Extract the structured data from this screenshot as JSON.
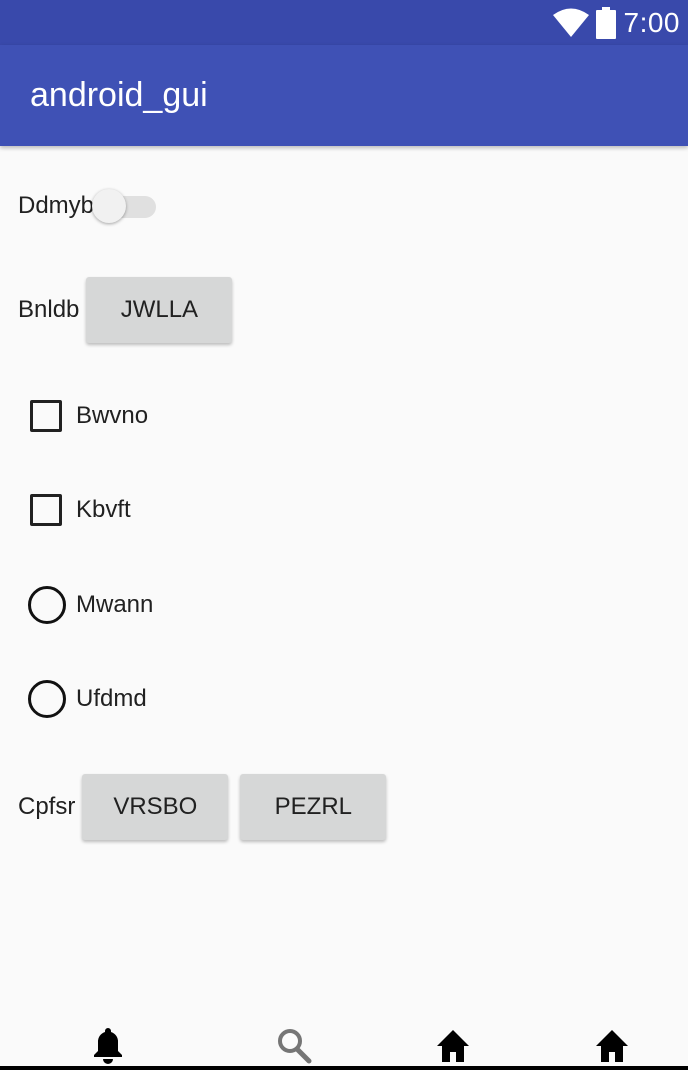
{
  "status_bar": {
    "time": "7:00"
  },
  "app_bar": {
    "title": "android_gui"
  },
  "switch_row": {
    "label": "Ddmyb",
    "checked": false
  },
  "button_row_1": {
    "label": "Bnldb",
    "button": "JWLLA"
  },
  "checkboxes": [
    {
      "label": "Bwvno",
      "checked": false
    },
    {
      "label": "Kbvft",
      "checked": false
    }
  ],
  "radios": [
    {
      "label": "Mwann",
      "selected": false
    },
    {
      "label": "Ufdmd",
      "selected": false
    }
  ],
  "button_row_2": {
    "label": "Cpfsr",
    "buttons": [
      "VRSBO",
      "PEZRL"
    ]
  },
  "bottom_nav": {
    "items": [
      {
        "icon": "bell-icon",
        "color": "#000000"
      },
      {
        "icon": "search-icon",
        "color": "#757575"
      },
      {
        "icon": "home-icon",
        "color": "#000000"
      },
      {
        "icon": "home-icon",
        "color": "#000000"
      }
    ]
  },
  "colors": {
    "status_bar": "#3949ab",
    "app_bar": "#3f51b5",
    "background": "#fafafa",
    "button": "#d6d7d7"
  }
}
